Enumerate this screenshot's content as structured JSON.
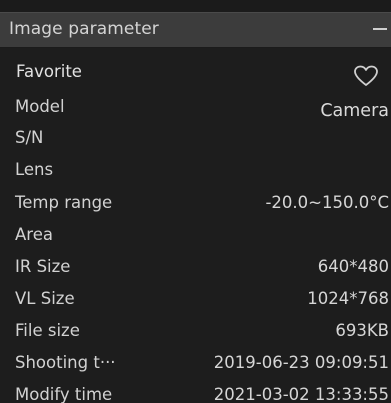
{
  "title": "Image parameter",
  "favorite": {
    "label": "Favorite"
  },
  "fields": [
    {
      "label": "Model",
      "value": "Camera"
    },
    {
      "label": "S/N",
      "value": ""
    },
    {
      "label": "Lens",
      "value": ""
    },
    {
      "label": "Temp range",
      "value": "-20.0~150.0°C"
    },
    {
      "label": "Area",
      "value": ""
    },
    {
      "label": "IR Size",
      "value": "640*480"
    },
    {
      "label": "VL Size",
      "value": "1024*768"
    },
    {
      "label": "File size",
      "value": "693KB"
    },
    {
      "label": "Shooting t···",
      "value": "2019-06-23 09:09:51"
    },
    {
      "label": "Modify time",
      "value": "2021-03-02 13:33:55"
    }
  ],
  "icons": {
    "minimize": "minimize-icon",
    "favorite": "heart-outline-icon"
  }
}
